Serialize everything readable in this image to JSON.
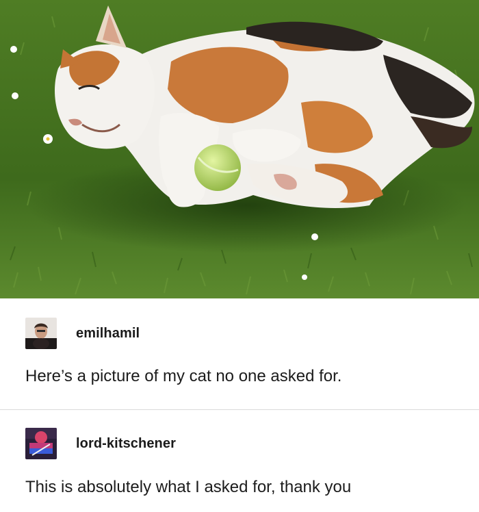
{
  "photo": {
    "subject": "calico cat lying on grass hugging a tennis ball",
    "colors": {
      "grass": "#4d7a26",
      "fur_white": "#f2f0ec",
      "fur_orange": "#c9793a",
      "fur_black": "#2a2420",
      "ball": "#b8db6a"
    }
  },
  "posts": [
    {
      "username": "emilhamil",
      "avatar_icon": "person-avatar",
      "text": "Here’s a picture of my cat no one asked for."
    },
    {
      "username": "lord-kitschener",
      "avatar_icon": "cartoon-avatar",
      "text": "This is absolutely what I asked for, thank you"
    }
  ]
}
